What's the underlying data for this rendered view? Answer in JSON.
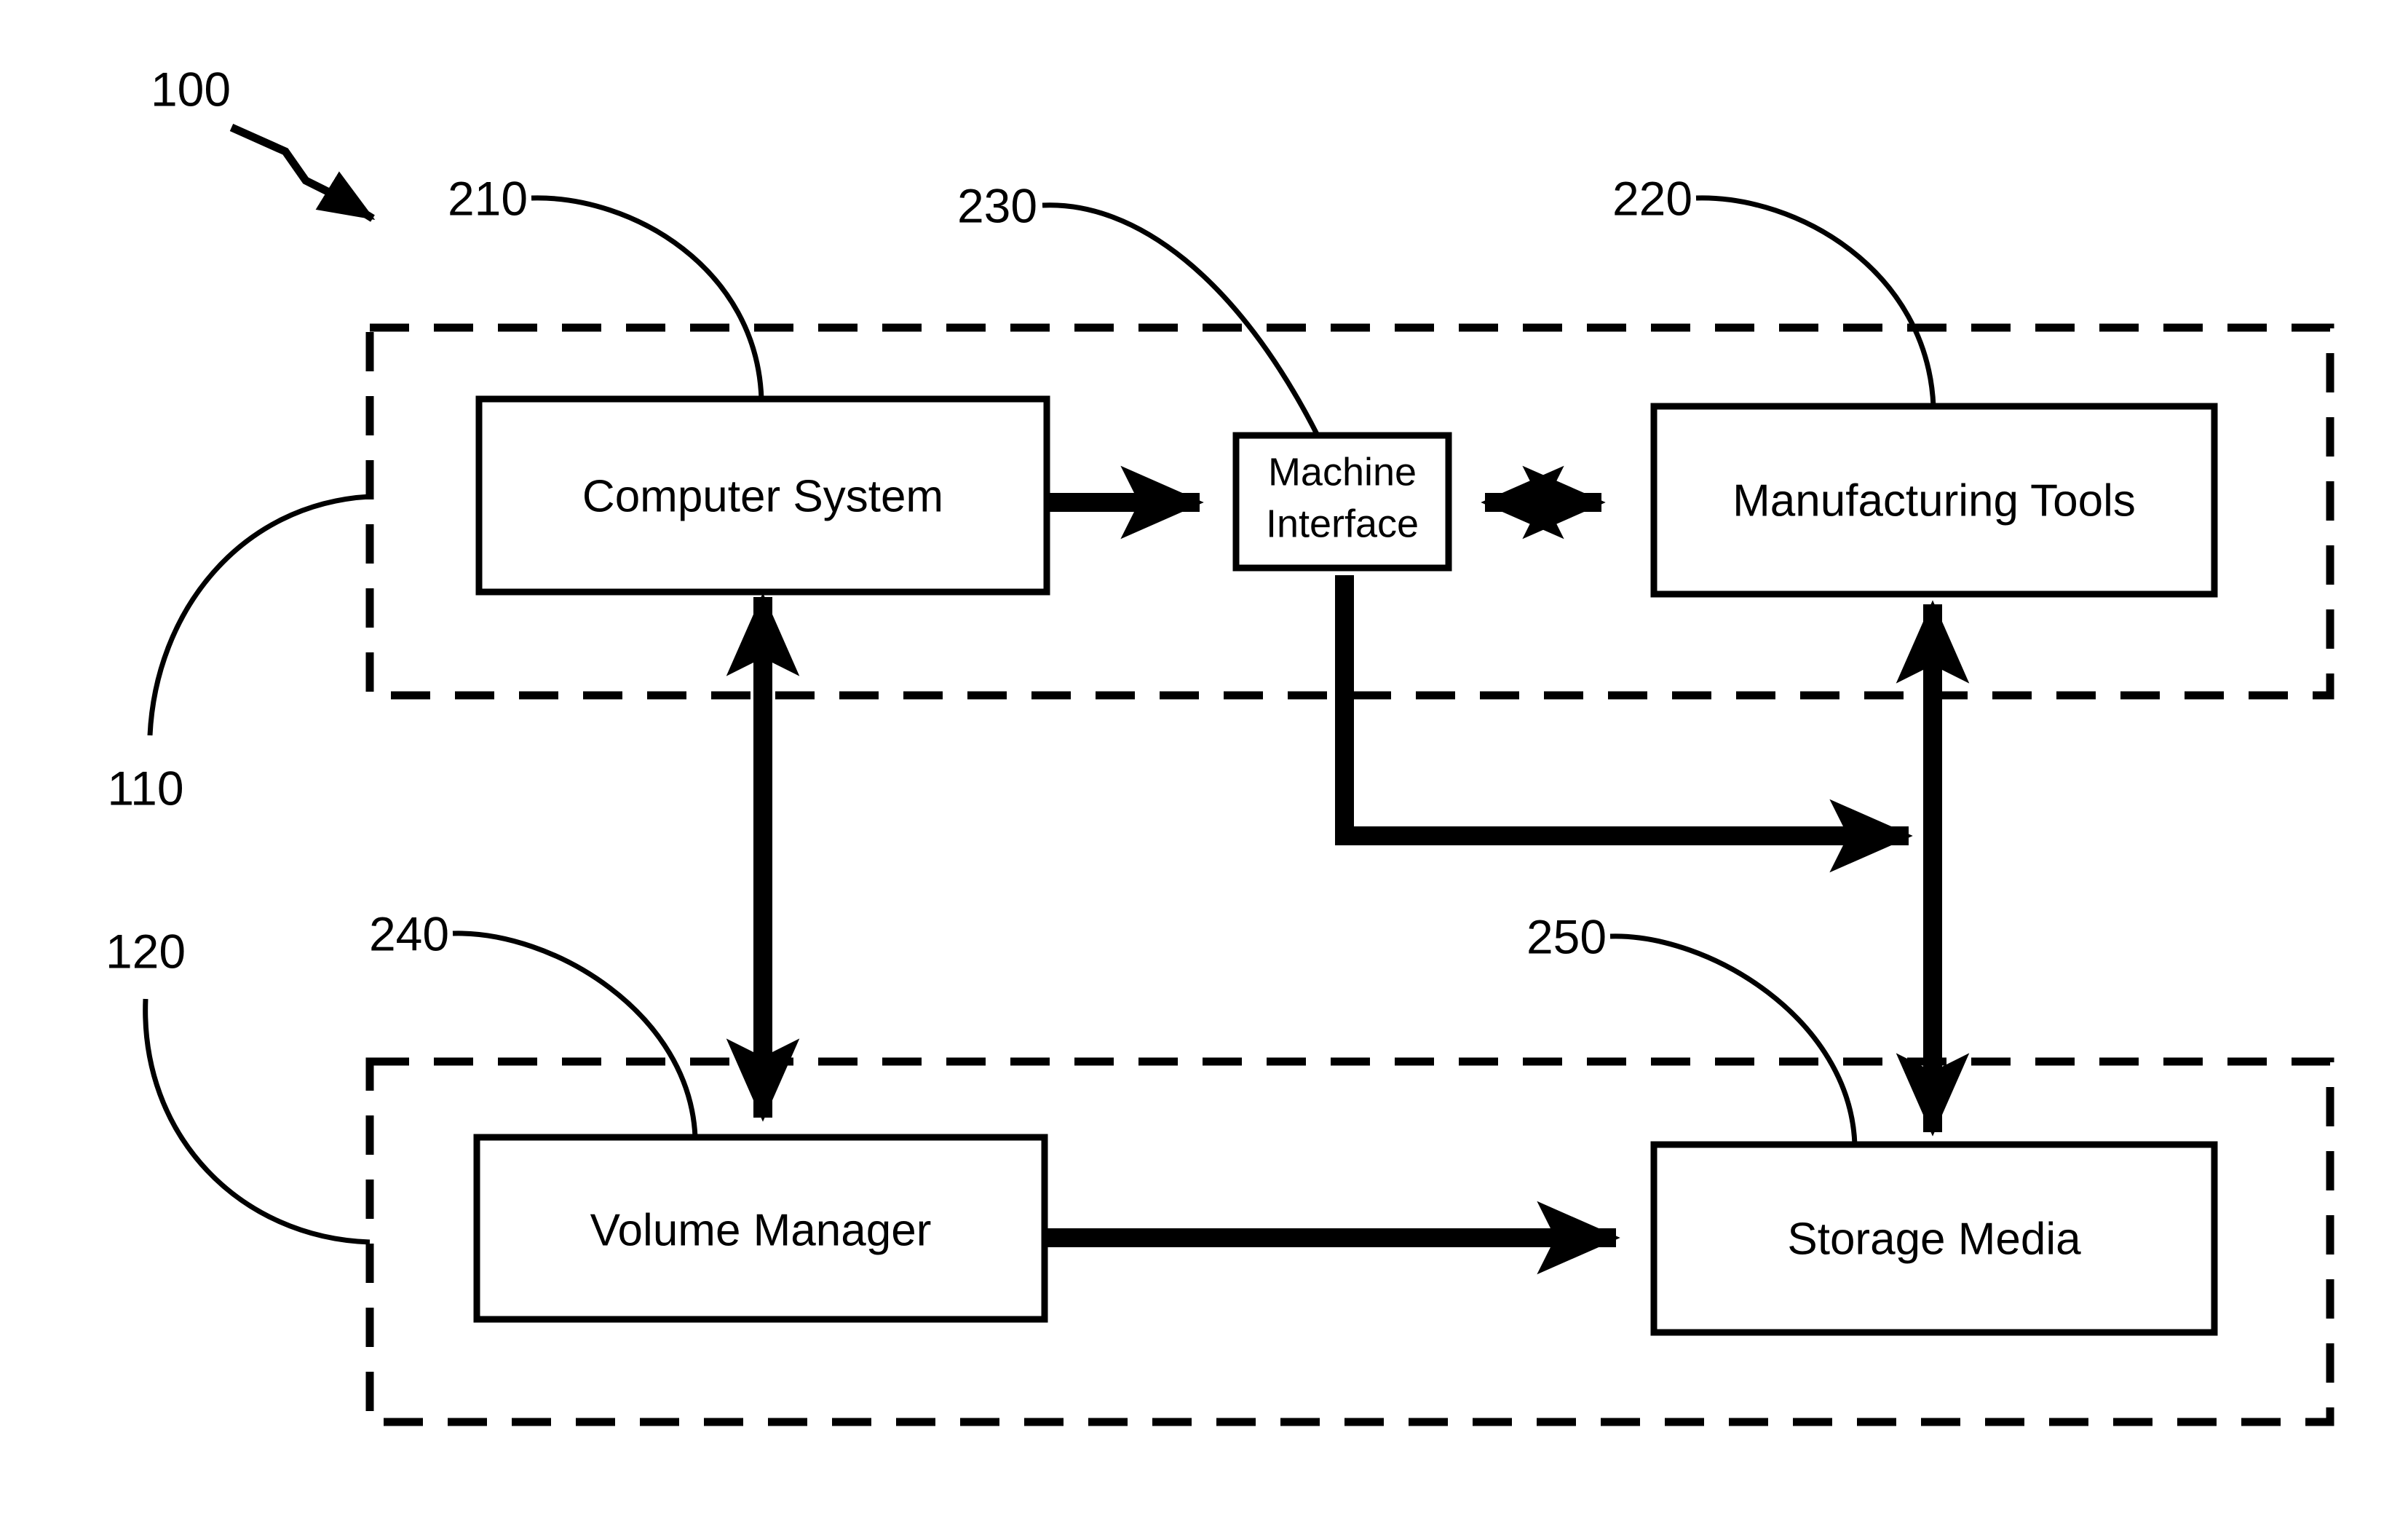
{
  "figure": {
    "type": "patent-block-diagram",
    "background_color": "#ffffff",
    "line_color": "#000000",
    "reference_numerals": {
      "system": "100",
      "upper_group": "110",
      "lower_group": "120",
      "computer_system": "210",
      "manufacturing_tools": "220",
      "machine_interface": "230",
      "volume_manager": "240",
      "storage_media": "250"
    },
    "blocks": [
      {
        "id": "computer-system",
        "label": "Computer System",
        "group": "110"
      },
      {
        "id": "machine-interface",
        "label": "Machine\nInterface",
        "line1": "Machine",
        "line2": "Interface",
        "group": "110"
      },
      {
        "id": "manufacturing-tools",
        "label": "Manufacturing Tools",
        "group": "110"
      },
      {
        "id": "volume-manager",
        "label": "Volume Manager",
        "group": "120"
      },
      {
        "id": "storage-media",
        "label": "Storage Media",
        "group": "120"
      }
    ],
    "connections": [
      {
        "from": "computer-system",
        "to": "machine-interface",
        "arrow": "bidirectional",
        "orientation": "horizontal"
      },
      {
        "from": "machine-interface",
        "to": "manufacturing-tools",
        "arrow": "bidirectional",
        "orientation": "horizontal"
      },
      {
        "from": "computer-system",
        "to": "volume-manager",
        "arrow": "bidirectional",
        "orientation": "vertical"
      },
      {
        "from": "manufacturing-tools",
        "to": "storage-media",
        "arrow": "bidirectional",
        "orientation": "vertical"
      },
      {
        "from": "volume-manager",
        "to": "storage-media",
        "arrow": "bidirectional",
        "orientation": "horizontal"
      },
      {
        "from": "machine-interface",
        "to": "manufacturing-tools-storage-link",
        "arrow": "single",
        "orientation": "elbow"
      }
    ],
    "groups": [
      {
        "id": "upper-group",
        "ref": "110",
        "style": "dashed"
      },
      {
        "id": "lower-group",
        "ref": "120",
        "style": "dashed"
      }
    ]
  }
}
